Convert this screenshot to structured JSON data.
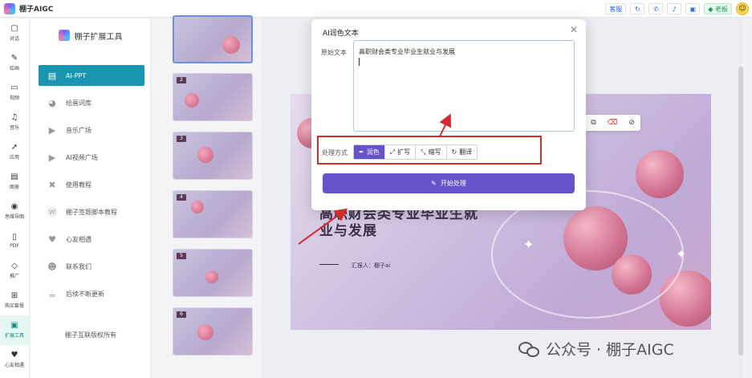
{
  "app": {
    "title": "棚子AIGC"
  },
  "topbar": {
    "service": "客服",
    "vip": "老板",
    "accent": "#1a9e55"
  },
  "rail": {
    "items": [
      {
        "label": "对话",
        "icon": "chat-icon"
      },
      {
        "label": "绘画",
        "icon": "brush-icon"
      },
      {
        "label": "视频",
        "icon": "video-icon"
      },
      {
        "label": "音乐",
        "icon": "music-icon"
      },
      {
        "label": "应用",
        "icon": "rocket-icon"
      },
      {
        "label": "图册",
        "icon": "gallery-icon"
      },
      {
        "label": "思维导图",
        "icon": "mindmap-icon"
      },
      {
        "label": "PDF",
        "icon": "pdf-icon"
      },
      {
        "label": "推广",
        "icon": "diamond-icon"
      },
      {
        "label": "购买套餐",
        "icon": "cart-icon"
      },
      {
        "label": "扩展工具",
        "icon": "toolbox-icon"
      },
      {
        "label": "心友相遇",
        "icon": "heart-icon"
      }
    ]
  },
  "sidebar": {
    "title": "棚子扩展工具",
    "items": [
      {
        "label": "AI-PPT",
        "icon": "document-icon"
      },
      {
        "label": "绘画词库",
        "icon": "reddit-icon"
      },
      {
        "label": "音乐广场",
        "icon": "play-icon"
      },
      {
        "label": "AI视频广场",
        "icon": "youtube-icon"
      },
      {
        "label": "使用教程",
        "icon": "tutorial-icon"
      },
      {
        "label": "棚子签题脚本教程",
        "icon": "wordpress-icon"
      },
      {
        "label": "心友相遇",
        "icon": "heartbeat-icon"
      },
      {
        "label": "联系我们",
        "icon": "user-icon"
      },
      {
        "label": "后续不断更新",
        "icon": "cup-icon"
      }
    ],
    "footer": "棚子互联版权所有"
  },
  "slides": {
    "thumbs": [
      "2",
      "3",
      "4",
      "5",
      "6"
    ]
  },
  "canvas": {
    "title": "高职财会类专业毕业生就业与发展",
    "presenter": "汇报人：棚子ai",
    "watermark": "公众号 · 棚子AIGC"
  },
  "dialog": {
    "title": "AI润色文本",
    "original_label": "原始文本",
    "original_text": "高职财会类专业毕业生就业与发展",
    "mode_label": "处理方式",
    "modes": [
      {
        "label": "润色",
        "icon": "pen-icon",
        "active": true
      },
      {
        "label": "扩写",
        "icon": "expand-icon",
        "active": false
      },
      {
        "label": "缩写",
        "icon": "shrink-icon",
        "active": false
      },
      {
        "label": "翻译",
        "icon": "translate-icon",
        "active": false
      }
    ],
    "run_label": "开始处理",
    "accent": "#6453c9"
  },
  "annotation": {
    "color": "#d62b2b"
  }
}
